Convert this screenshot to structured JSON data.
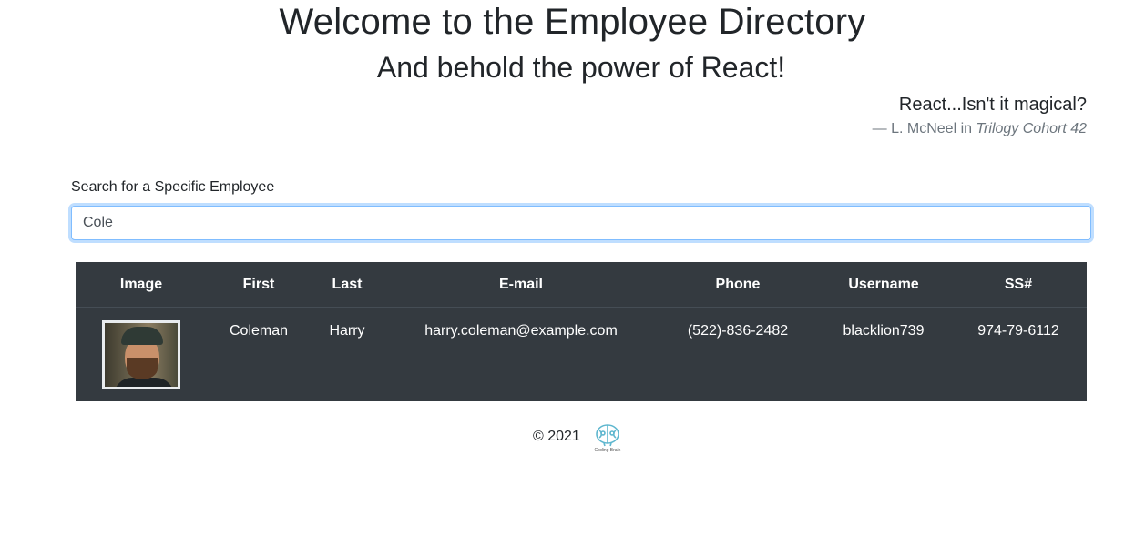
{
  "header": {
    "title": "Welcome to the Employee Directory",
    "subtitle": "And behold the power of React!"
  },
  "quote": {
    "text": "React...Isn't it magical?",
    "author_prefix": "— L. McNeel in ",
    "source": "Trilogy Cohort 42"
  },
  "search": {
    "label": "Search for a Specific Employee",
    "value": "Cole"
  },
  "table": {
    "columns": [
      "Image",
      "First",
      "Last",
      "E-mail",
      "Phone",
      "Username",
      "SS#"
    ],
    "rows": [
      {
        "first": "Coleman",
        "last": "Harry",
        "email": "harry.coleman@example.com",
        "phone": "(522)-836-2482",
        "username": "blacklion739",
        "ssn": "974-79-6112"
      }
    ]
  },
  "footer": {
    "copyright": "© 2021",
    "logo_text": "Coding Brain"
  },
  "colors": {
    "table_bg": "#343a40",
    "focus_border": "#80bdff",
    "logo": "#5fb7cf"
  }
}
